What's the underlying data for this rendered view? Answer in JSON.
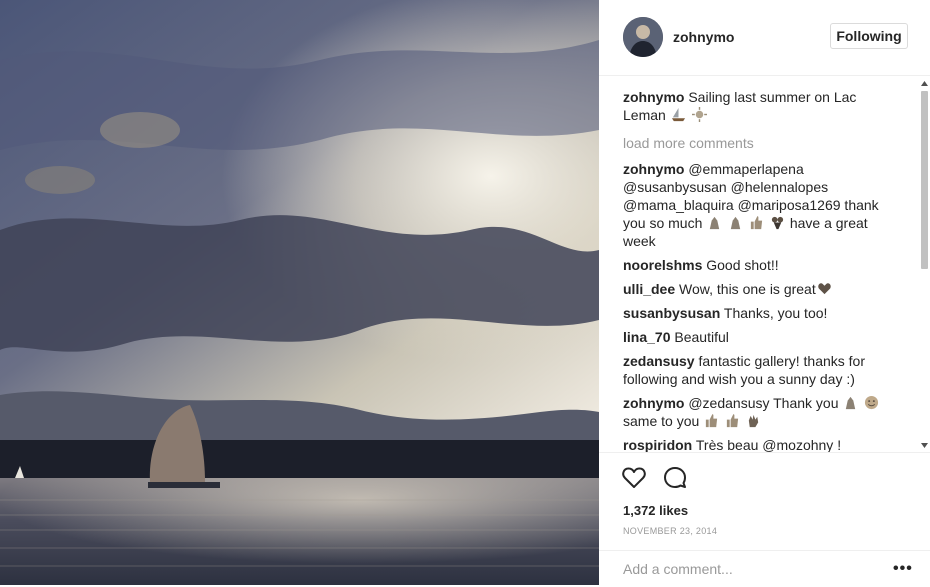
{
  "post": {
    "username": "zohnymo",
    "follow_label": "Following",
    "caption": {
      "user": "zohnymo",
      "text": "Sailing last summer on Lac Leman"
    },
    "load_more": "load more comments",
    "comments": [
      {
        "user": "zohnymo",
        "text": "@emmaperlapena @susanbysusan @helennalopes @mama_blaquira @mariposa1269 thank you so much",
        "tail": "have a great week"
      },
      {
        "user": "noorelshms",
        "text": "Good shot!!"
      },
      {
        "user": "ulli_dee",
        "text": "Wow, this one is great"
      },
      {
        "user": "susanbysusan",
        "text": "Thanks, you too!"
      },
      {
        "user": "lina_70",
        "text": "Beautiful"
      },
      {
        "user": "zedansusy",
        "text": "fantastic gallery! thanks for following and wish you a sunny day :)"
      },
      {
        "user": "zohnymo",
        "text": "@zedansusy Thank you",
        "tail": "same to you"
      },
      {
        "user": "rospiridon",
        "text": "Très beau @mozohny ! Couleur"
      }
    ],
    "likes": "1,372 likes",
    "date": "NOVEMBER 23, 2014",
    "add_comment_placeholder": "Add a comment...",
    "more_label": "•••",
    "icons": {
      "like": "heart-icon",
      "comment": "speech-bubble-icon",
      "options": "ellipsis-icon"
    }
  }
}
